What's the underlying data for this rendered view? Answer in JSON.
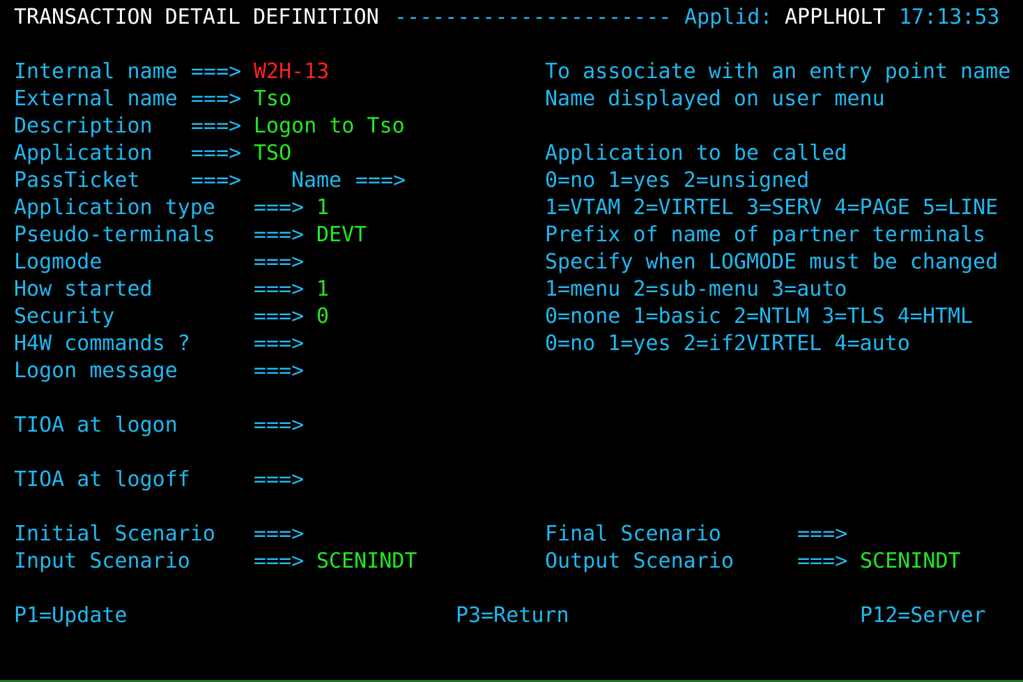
{
  "header": {
    "title": "TRANSACTION DETAIL DEFINITION",
    "dashes": "----------------------",
    "applid_label": "Applid:",
    "applid_value": "APPLHOLT",
    "time": "17:13:53"
  },
  "arrow": "===>",
  "fields": {
    "internal_name": {
      "label": "Internal name",
      "value": "W2H-13",
      "help": "To associate with an entry point name"
    },
    "external_name": {
      "label": "External name",
      "value": "Tso",
      "help": "Name displayed on user menu"
    },
    "description": {
      "label": "Description",
      "value": "Logon to Tso"
    },
    "application": {
      "label": "Application",
      "value": "TSO",
      "help": "Application to be called"
    },
    "passticket": {
      "label": "PassTicket",
      "value": "",
      "name_label": "Name",
      "name_value": "",
      "help": "0=no 1=yes 2=unsigned"
    },
    "application_type": {
      "label": "Application type",
      "value": "1",
      "help": "1=VTAM 2=VIRTEL 3=SERV 4=PAGE 5=LINE"
    },
    "pseudo_terminals": {
      "label": "Pseudo-terminals",
      "value": "DEVT",
      "help": "Prefix of name of partner terminals"
    },
    "logmode": {
      "label": "Logmode",
      "value": "",
      "help": "Specify when LOGMODE must be changed"
    },
    "how_started": {
      "label": "How started",
      "value": "1",
      "help": "1=menu 2=sub-menu 3=auto"
    },
    "security": {
      "label": "Security",
      "value": "0",
      "help": "0=none 1=basic 2=NTLM 3=TLS 4=HTML"
    },
    "h4w_commands": {
      "label": "H4W commands ?",
      "value": "",
      "help": "0=no 1=yes 2=if2VIRTEL 4=auto"
    },
    "logon_message": {
      "label": "Logon message",
      "value": ""
    },
    "tioa_logon": {
      "label": "TIOA at logon",
      "value": ""
    },
    "tioa_logoff": {
      "label": "TIOA at logoff",
      "value": ""
    },
    "initial_scenario": {
      "label": "Initial Scenario",
      "value": ""
    },
    "final_scenario": {
      "label": "Final Scenario",
      "value": ""
    },
    "input_scenario": {
      "label": "Input Scenario",
      "value": "SCENINDT"
    },
    "output_scenario": {
      "label": "Output Scenario",
      "value": "SCENINDT"
    }
  },
  "function_keys": {
    "p1": "P1=Update",
    "p3": "P3=Return",
    "p12": "P12=Server"
  },
  "colors": {
    "background": "#000000",
    "label": "#20b8f0",
    "title": "#ffffff",
    "value": "#22e822",
    "key_value": "#ff2020"
  }
}
